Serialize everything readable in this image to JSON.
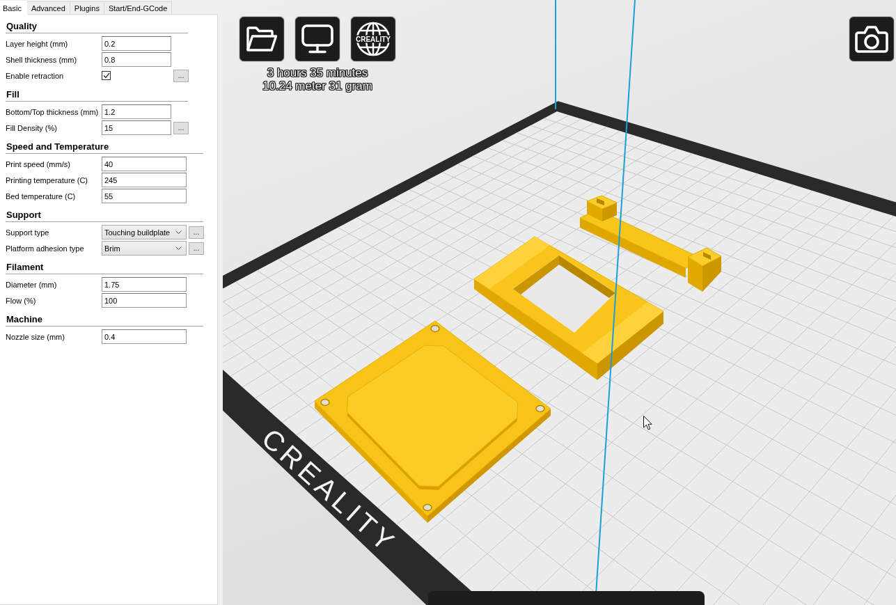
{
  "tabs": [
    {
      "label": "Basic",
      "selected": true
    },
    {
      "label": "Advanced",
      "selected": false
    },
    {
      "label": "Plugins",
      "selected": false
    },
    {
      "label": "Start/End-GCode",
      "selected": false
    }
  ],
  "sections": [
    {
      "title": "Quality",
      "rows": [
        {
          "kind": "text",
          "label": "Layer height (mm)",
          "value": "0.2"
        },
        {
          "kind": "text",
          "label": "Shell thickness (mm)",
          "value": "0.8"
        },
        {
          "kind": "checkbox",
          "label": "Enable retraction",
          "checked": true,
          "button": "..."
        }
      ]
    },
    {
      "title": "Fill",
      "rows": [
        {
          "kind": "text",
          "label": "Bottom/Top thickness (mm)",
          "value": "1.2"
        },
        {
          "kind": "text",
          "label": "Fill Density (%)",
          "value": "15",
          "button": "..."
        }
      ]
    },
    {
      "title": "Speed and Temperature",
      "rows": [
        {
          "kind": "text",
          "label": "Print speed (mm/s)",
          "value": "40"
        },
        {
          "kind": "text",
          "label": "Printing temperature (C)",
          "value": "245"
        },
        {
          "kind": "text",
          "label": "Bed temperature (C)",
          "value": "55"
        }
      ]
    },
    {
      "title": "Support",
      "rows": [
        {
          "kind": "select",
          "label": "Support type",
          "value": "Touching buildplate",
          "button": "..."
        },
        {
          "kind": "select",
          "label": "Platform adhesion type",
          "value": "Brim",
          "button": "..."
        }
      ]
    },
    {
      "title": "Filament",
      "rows": [
        {
          "kind": "text",
          "label": "Diameter (mm)",
          "value": "1.75"
        },
        {
          "kind": "text",
          "label": "Flow (%)",
          "value": "100"
        }
      ]
    },
    {
      "title": "Machine",
      "rows": [
        {
          "kind": "text",
          "label": "Nozzle size (mm)",
          "value": "0.4"
        }
      ]
    }
  ],
  "viewport": {
    "toolbar": [
      {
        "kind": "folder"
      },
      {
        "kind": "monitor"
      },
      {
        "kind": "globe",
        "label": "CREALITY"
      }
    ],
    "print_info": [
      "3 hours 35 minutes",
      "10.24 meter 31 gram"
    ],
    "right_toolbar": [
      {
        "kind": "camera"
      }
    ],
    "bed_logo": "CREALITY",
    "models": [
      {
        "kind": "plate"
      },
      {
        "kind": "frame"
      },
      {
        "kind": "bracket"
      }
    ]
  }
}
